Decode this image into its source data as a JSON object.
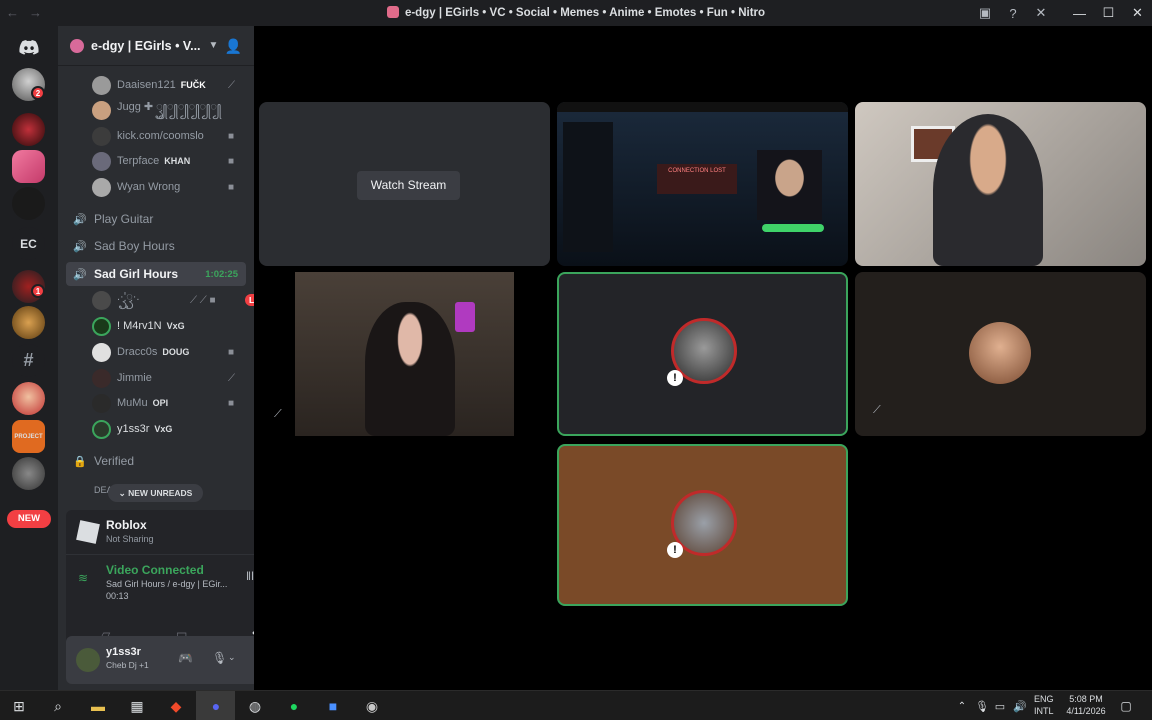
{
  "window": {
    "title": "e-dgy | EGirls • VC • Social • Memes • Anime • Emotes • Fun • Nitro"
  },
  "rail": {
    "servers": [
      {
        "name": "avatar-1",
        "badge": "2"
      },
      {
        "name": "server-2"
      },
      {
        "name": "server-3"
      },
      {
        "name": "server-4"
      },
      {
        "name": "server-ec",
        "label": "EC"
      },
      {
        "name": "server-6",
        "badge": "1"
      },
      {
        "name": "server-7"
      },
      {
        "name": "server-8"
      },
      {
        "name": "server-9"
      },
      {
        "name": "server-project"
      },
      {
        "name": "server-11"
      }
    ],
    "new_label": "NEW"
  },
  "sidebar": {
    "guild_name": "e-dgy | EGirls • V...",
    "prev_channel_users": [
      {
        "name": "Daaisen121",
        "tag": "FUČK"
      },
      {
        "name": "Jugg ✚ ꦽ꧀꧀꧀꧀꧀꧀"
      },
      {
        "name": "kick.com/coomslo"
      },
      {
        "name": "Terpface",
        "tag": "KHAN"
      },
      {
        "name": "Wyan Wrong"
      }
    ],
    "channels": [
      {
        "name": "Play Guitar"
      },
      {
        "name": "Sad Boy Hours"
      },
      {
        "name": "Sad Girl Hours",
        "timer": "1:02:25"
      }
    ],
    "active_users": [
      {
        "name": ".·'ꦽꦽ·.",
        "live": "LIVE"
      },
      {
        "name": "! M4rv1N",
        "tag": "VxG"
      },
      {
        "name": "Dracc0s",
        "tag": "DOUG"
      },
      {
        "name": "Jimmie"
      },
      {
        "name": "MuMu",
        "tag": "OPI"
      },
      {
        "name": "y1ss3r",
        "tag": "VxG"
      }
    ],
    "locked_channels": [
      {
        "name": "Verified"
      },
      {
        "name": "DEA"
      }
    ],
    "new_unreads_label": "NEW UNREADS"
  },
  "activity": {
    "app_name": "Roblox",
    "status": "Not Sharing"
  },
  "voice": {
    "status": "Video Connected",
    "channel": "Sad Girl Hours / e-dgy | EGir...",
    "elapsed": "00:13"
  },
  "user": {
    "name": "y1ss3r",
    "status": "Cheb Dj +1"
  },
  "stage": {
    "watch_stream_label": "Watch Stream",
    "stream_overlay_text": "CONNECTION LOST"
  },
  "taskbar": {
    "language": "ENG",
    "layout": "INTL",
    "time": "5:08 PM",
    "date": "4/11/2026"
  }
}
